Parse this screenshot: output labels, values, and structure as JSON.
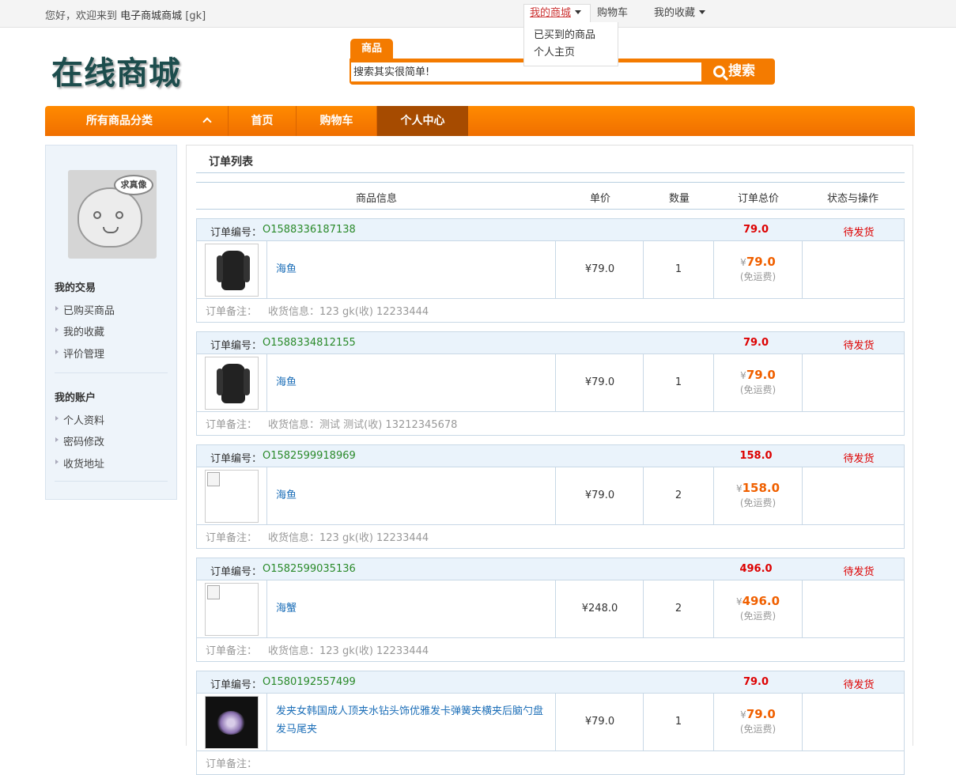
{
  "topbar": {
    "welcome_prefix": "您好，欢迎来到",
    "site_name": "电子商城商城",
    "user": "[gk]",
    "my_mall": "我的商城",
    "cart": "购物车",
    "favorites": "我的收藏",
    "dropdown": [
      "已买到的商品",
      "个人主页"
    ]
  },
  "header": {
    "logo": "在线商城",
    "search_tab": "商品",
    "search_placeholder": "搜索其实很简单!",
    "search_button": "搜索"
  },
  "nav": {
    "all_categories": "所有商品分类",
    "home": "首页",
    "cart": "购物车",
    "user_center": "个人中心"
  },
  "sidebar": {
    "avatar_bubble": "求真像",
    "trade_heading": "我的交易",
    "trade_links": [
      "已购买商品",
      "我的收藏",
      "评价管理"
    ],
    "account_heading": "我的账户",
    "account_links": [
      "个人资料",
      "密码修改",
      "收货地址"
    ]
  },
  "main": {
    "title": "订单列表",
    "columns": [
      "商品信息",
      "单价",
      "数量",
      "订单总价",
      "状态与操作"
    ],
    "order_no_label": "订单编号：",
    "note_label": "订单备注：",
    "yen": "¥",
    "shipping_free": "(免运费)",
    "orders": [
      {
        "order_no": "O1588336187138",
        "total": "79.0",
        "status": "待发货",
        "product": "海鱼",
        "unit_price": "¥79.0",
        "quantity": "1",
        "total_big": "79.0",
        "ship_info": "收货信息：123 gk(收) 12233444",
        "image": "backpack"
      },
      {
        "order_no": "O1588334812155",
        "total": "79.0",
        "status": "待发货",
        "product": "海鱼",
        "unit_price": "¥79.0",
        "quantity": "1",
        "total_big": "79.0",
        "ship_info": "收货信息：测试 测试(收) 13212345678",
        "image": "backpack"
      },
      {
        "order_no": "O1582599918969",
        "total": "158.0",
        "status": "待发货",
        "product": "海鱼",
        "unit_price": "¥79.0",
        "quantity": "2",
        "total_big": "158.0",
        "ship_info": "收货信息：123 gk(收) 12233444",
        "image": "broken"
      },
      {
        "order_no": "O1582599035136",
        "total": "496.0",
        "status": "待发货",
        "product": "海蟹",
        "unit_price": "¥248.0",
        "quantity": "2",
        "total_big": "496.0",
        "ship_info": "收货信息：123 gk(收) 12233444",
        "image": "broken"
      },
      {
        "order_no": "O1580192557499",
        "total": "79.0",
        "status": "待发货",
        "product": "发夹女韩国成人顶夹水钻头饰优雅发卡弹簧夹横夹后脑勺盘发马尾夹",
        "unit_price": "¥79.0",
        "quantity": "1",
        "total_big": "79.0",
        "ship_info": "",
        "image": "hairclip"
      }
    ]
  },
  "colors": {
    "accent": "#f47b00",
    "nav_active": "#a64b00",
    "order_no": "#2a8a2a",
    "status_red": "#dd0000",
    "link_blue": "#1d6fb8"
  }
}
